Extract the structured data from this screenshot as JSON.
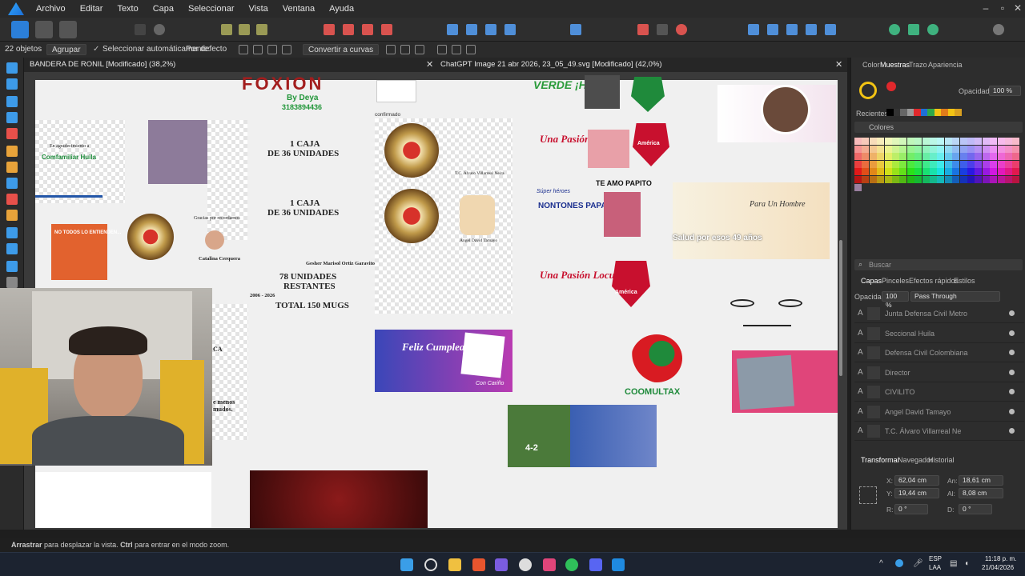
{
  "menu": {
    "items": [
      "Archivo",
      "Editar",
      "Texto",
      "Capa",
      "Seleccionar",
      "Vista",
      "Ventana",
      "Ayuda"
    ]
  },
  "context_bar": {
    "objects_count": "22 objetos",
    "group_button": "Agrupar",
    "auto_select_label": "Seleccionar automáticamente:",
    "auto_select_value": "Por defecto",
    "convert_curves": "Convertir a curvas"
  },
  "doc_tabs": [
    {
      "label": "BANDERA DE RONIL [Modificado] (38,2%)"
    },
    {
      "label": "ChatGPT Image 21 abr 2026, 23_05_49.svg [Modificado] (42,0%)"
    }
  ],
  "canvas": {
    "fixion_logo": "FOXION",
    "by_deya": "By Deya",
    "phone": "3183894436",
    "caja1_line1": "1 CAJA",
    "caja1_line2": "DE 36 UNIDADES",
    "caja2_line1": "1 CAJA",
    "caja2_line2": "DE 36 UNIDADES",
    "unidades_line1": "78 UNIDADES",
    "unidades_line2": "RESTANTES",
    "total": "TOTAL 150 MUGS",
    "years_left": "2006 - 2026",
    "gesher": "Gesher Marisol Ortiz Garavito",
    "confirmado": "confirmado",
    "agradecimiento": "En agradecimiento a",
    "comfamiliar": "Comfamiliar Huila",
    "no_todos": "NO TODOS LO ENTIENDEN...",
    "gracias": "Gracias por recordarnos",
    "catalina": "Catalina Cerquera",
    "menos_mudos": "e menos mudos.",
    "ca_partial": "CA",
    "angel_card_name": "Ángel David Tamayo",
    "alvaro_card": "T.C. Álvaro Villarreal Neira",
    "hpta": "VERDE ¡HPTA!",
    "pasion1": "Una Pasión Locura",
    "pasion2": "Una Pasión Locura",
    "america1": "América",
    "america2": "América",
    "te_amo": "TE AMO PAPITO",
    "super_heroes": "Súper héroes",
    "no_tienes_papas": "NONTONES PAPAS",
    "salud": "Salud por esos 49 años",
    "para_hombre": "Para Un Hombre",
    "feliz": "Feliz Cumpleaños",
    "con_carino": "Con Cariño",
    "coomultax": "COOMULTAX",
    "score": "4-2"
  },
  "right_panel": {
    "top_tabs": [
      "Color",
      "Muestras",
      "Trazo",
      "Apariencia"
    ],
    "opacity_label": "Opacidad:",
    "opacity_value": "100 %",
    "recientes_label": "Recientes:",
    "colores_label": "Colores",
    "search_placeholder": "Buscar",
    "layer_tabs": [
      "Capas",
      "Pinceles",
      "Efectos rápidos",
      "Estilos"
    ],
    "layer_opacity_label": "Opacidad:",
    "layer_opacity_value": "100 %",
    "blend_mode": "Pass Through",
    "layers": [
      "Junta Defensa Civil Metro",
      "Seccional Huila",
      "Defensa Civil Colombiana",
      "Director",
      "CIVILITO",
      "Angel David Tamayo",
      "T.C. Álvaro Villarreal Ne"
    ],
    "transform_tabs": [
      "Transformar",
      "Navegador",
      "Historial"
    ],
    "x_label": "X:",
    "x_value": "62,04 cm",
    "y_label": "Y:",
    "y_value": "19,44 cm",
    "w_label": "An:",
    "w_value": "18,61 cm",
    "h_label": "Al:",
    "h_value": "8,08 cm",
    "r_label": "R:",
    "r_value": "0 °",
    "s_label": "D:",
    "s_value": "0 °"
  },
  "status": {
    "drag": "Arrastrar",
    "drag_rest": " para desplazar la vista. ",
    "ctrl": "Ctrl",
    "ctrl_rest": " para entrar en el modo zoom."
  },
  "taskbar": {
    "lang1": "ESP",
    "lang2": "LAA",
    "time": "11:18 p. m.",
    "date": "21/04/2026"
  }
}
